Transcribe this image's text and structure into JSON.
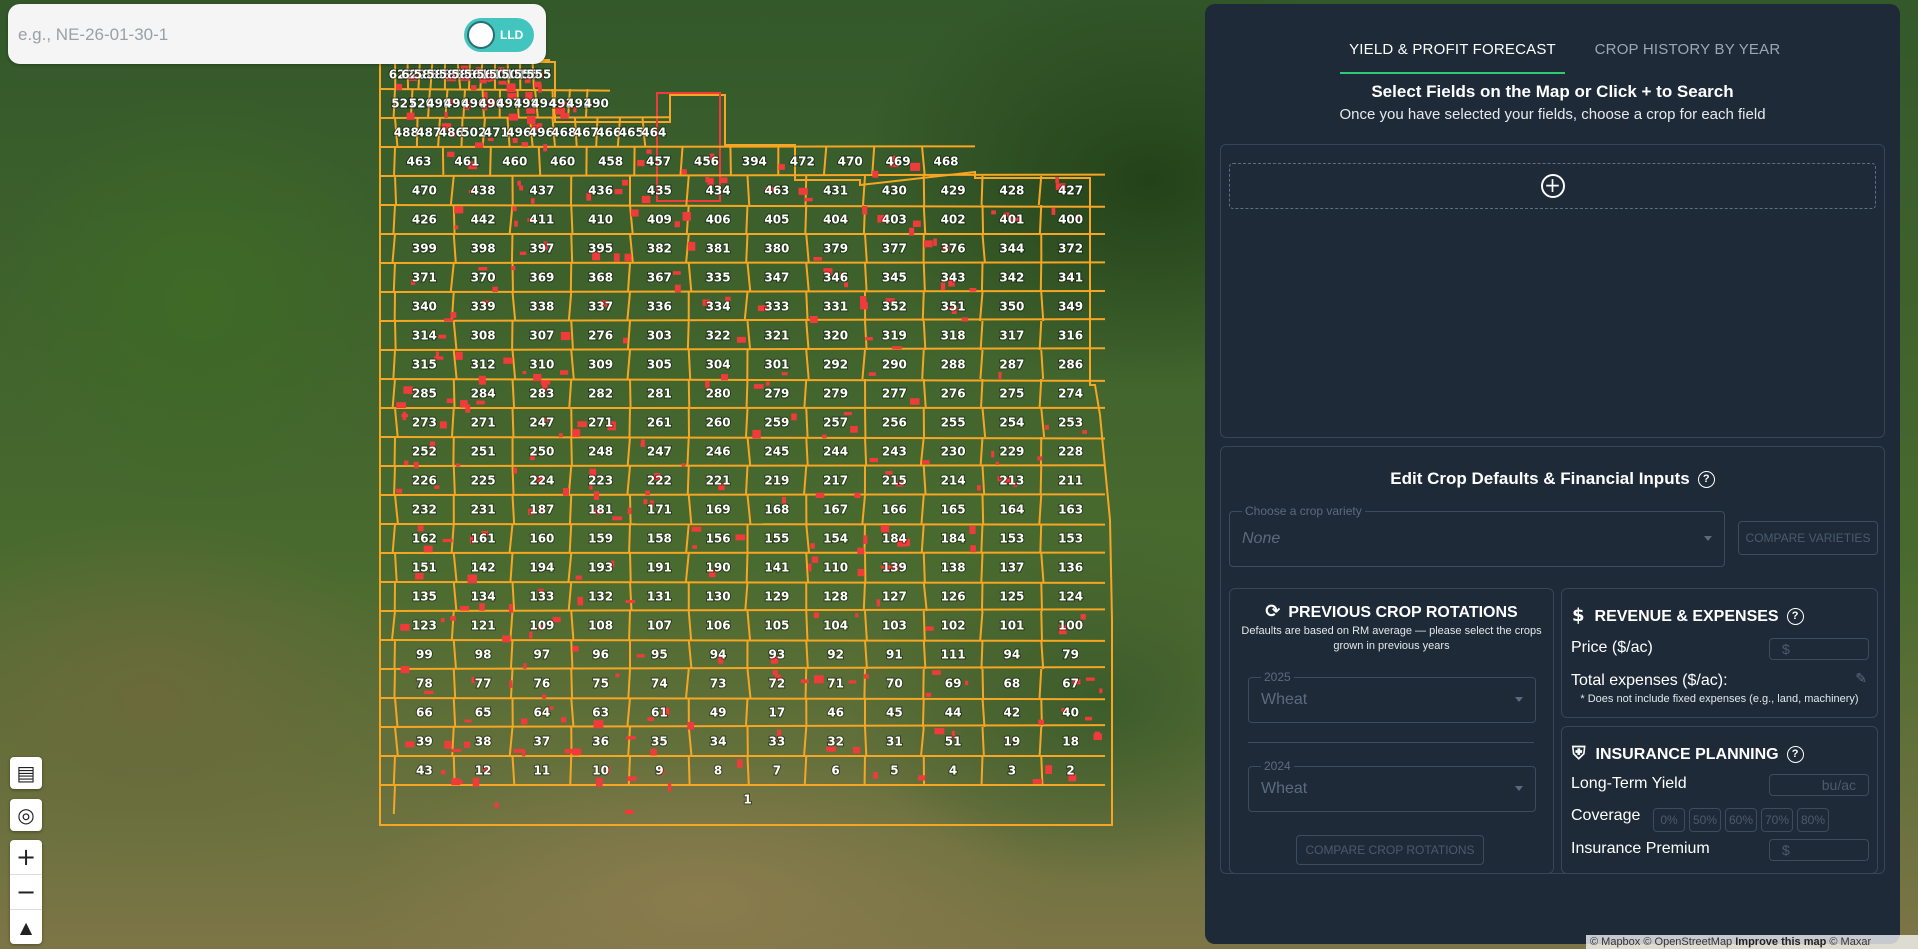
{
  "search": {
    "placeholder": "e.g., NE-26-01-30-1",
    "toggle_label": "LLD"
  },
  "map": {
    "boundary_color": "#f6a623",
    "highlight_color": "#f03b3b",
    "rm_numbers": [
      "622",
      "622",
      "588",
      "588",
      "588",
      "588",
      "561",
      "561",
      "501",
      "501",
      "555",
      "555",
      "521",
      "520",
      "499",
      "496",
      "496",
      "496",
      "497",
      "498",
      "494",
      "493",
      "491",
      "490",
      "488",
      "487",
      "486",
      "502",
      "471",
      "496",
      "496",
      "468",
      "467",
      "466",
      "465",
      "464",
      "463",
      "461",
      "460",
      "460",
      "458",
      "457",
      "456",
      "394",
      "472",
      "470",
      "469",
      "468",
      "470",
      "438",
      "437",
      "436",
      "435",
      "434",
      "463",
      "431",
      "430",
      "429",
      "428",
      "427",
      "426",
      "442",
      "411",
      "410",
      "409",
      "406",
      "405",
      "404",
      "403",
      "402",
      "401",
      "400",
      "399",
      "398",
      "397",
      "395",
      "382",
      "381",
      "380",
      "379",
      "377",
      "376",
      "344",
      "372",
      "371",
      "370",
      "369",
      "368",
      "367",
      "335",
      "347",
      "346",
      "345",
      "343",
      "342",
      "341",
      "340",
      "339",
      "338",
      "337",
      "336",
      "334",
      "333",
      "331",
      "352",
      "351",
      "350",
      "349",
      "314",
      "308",
      "307",
      "276",
      "303",
      "322",
      "321",
      "320",
      "319",
      "318",
      "317",
      "316",
      "315",
      "312",
      "310",
      "309",
      "305",
      "304",
      "301",
      "292",
      "290",
      "288",
      "287",
      "286",
      "285",
      "284",
      "283",
      "282",
      "281",
      "280",
      "279",
      "279",
      "277",
      "276",
      "275",
      "274",
      "273",
      "271",
      "247",
      "271",
      "261",
      "260",
      "259",
      "257",
      "256",
      "255",
      "254",
      "253",
      "252",
      "251",
      "250",
      "248",
      "247",
      "246",
      "245",
      "244",
      "243",
      "230",
      "229",
      "228",
      "226",
      "225",
      "224",
      "223",
      "222",
      "221",
      "219",
      "217",
      "215",
      "214",
      "213",
      "211",
      "232",
      "231",
      "187",
      "181",
      "171",
      "169",
      "168",
      "167",
      "166",
      "165",
      "164",
      "163",
      "162",
      "161",
      "160",
      "159",
      "158",
      "156",
      "155",
      "154",
      "184",
      "184",
      "153",
      "153",
      "151",
      "142",
      "194",
      "193",
      "191",
      "190",
      "141",
      "110",
      "139",
      "138",
      "137",
      "136",
      "135",
      "134",
      "133",
      "132",
      "131",
      "130",
      "129",
      "128",
      "127",
      "126",
      "125",
      "124",
      "123",
      "121",
      "109",
      "108",
      "107",
      "106",
      "105",
      "104",
      "103",
      "102",
      "101",
      "100",
      "99",
      "98",
      "97",
      "96",
      "95",
      "94",
      "93",
      "92",
      "91",
      "111",
      "94",
      "79",
      "78",
      "77",
      "76",
      "75",
      "74",
      "73",
      "72",
      "71",
      "70",
      "69",
      "68",
      "67",
      "66",
      "65",
      "64",
      "63",
      "61",
      "49",
      "17",
      "46",
      "45",
      "44",
      "42",
      "40",
      "39",
      "38",
      "37",
      "36",
      "35",
      "34",
      "33",
      "32",
      "31",
      "51",
      "19",
      "18",
      "43",
      "12",
      "11",
      "10",
      "9",
      "8",
      "7",
      "6",
      "5",
      "4",
      "3",
      "2",
      "1"
    ]
  },
  "map_controls": {
    "layers": "layers-icon",
    "locate": "locate-icon",
    "zoom_in": "+",
    "zoom_out": "−",
    "compass": "compass-icon"
  },
  "panel": {
    "tabs": [
      {
        "label": "YIELD & PROFIT FORECAST",
        "active": true
      },
      {
        "label": "CROP HISTORY BY YEAR",
        "active": false
      }
    ],
    "select_title": "Select Fields on the Map or Click + to Search",
    "select_sub": "Once you have selected your fields, choose a crop for each field",
    "add_field": "+",
    "defaults_title": "Edit Crop Defaults & Financial Inputs",
    "variety": {
      "legend": "Choose a crop variety",
      "value": "None"
    },
    "compare_varieties": "COMPARE VARIETIES",
    "rotations": {
      "title": "PREVIOUS CROP ROTATIONS",
      "subtitle": "Defaults are based on RM average — please select the crops grown in previous years",
      "years": [
        {
          "year": "2025",
          "crop": "Wheat"
        },
        {
          "year": "2024",
          "crop": "Wheat"
        }
      ],
      "compare": "COMPARE CROP ROTATIONS"
    },
    "revenue": {
      "title": "REVENUE & EXPENSES",
      "price_label": "Price ($/ac)",
      "price_placeholder": "$",
      "expenses_label": "Total expenses ($/ac):",
      "note": "* Does not include fixed expenses (e.g., land, machinery)"
    },
    "insurance": {
      "title": "INSURANCE PLANNING",
      "yield_label": "Long-Term Yield",
      "yield_placeholder": "bu/ac",
      "coverage_label": "Coverage",
      "coverage_options": [
        "0%",
        "50%",
        "60%",
        "70%",
        "80%"
      ],
      "premium_label": "Insurance Premium",
      "premium_placeholder": "$"
    },
    "accent_color": "#2ecc71",
    "background_color": "#1e2a38"
  },
  "attribution": {
    "mapbox": "© Mapbox",
    "osm": "© OpenStreetMap",
    "improve": "Improve this map",
    "maxar": "© Maxar"
  }
}
